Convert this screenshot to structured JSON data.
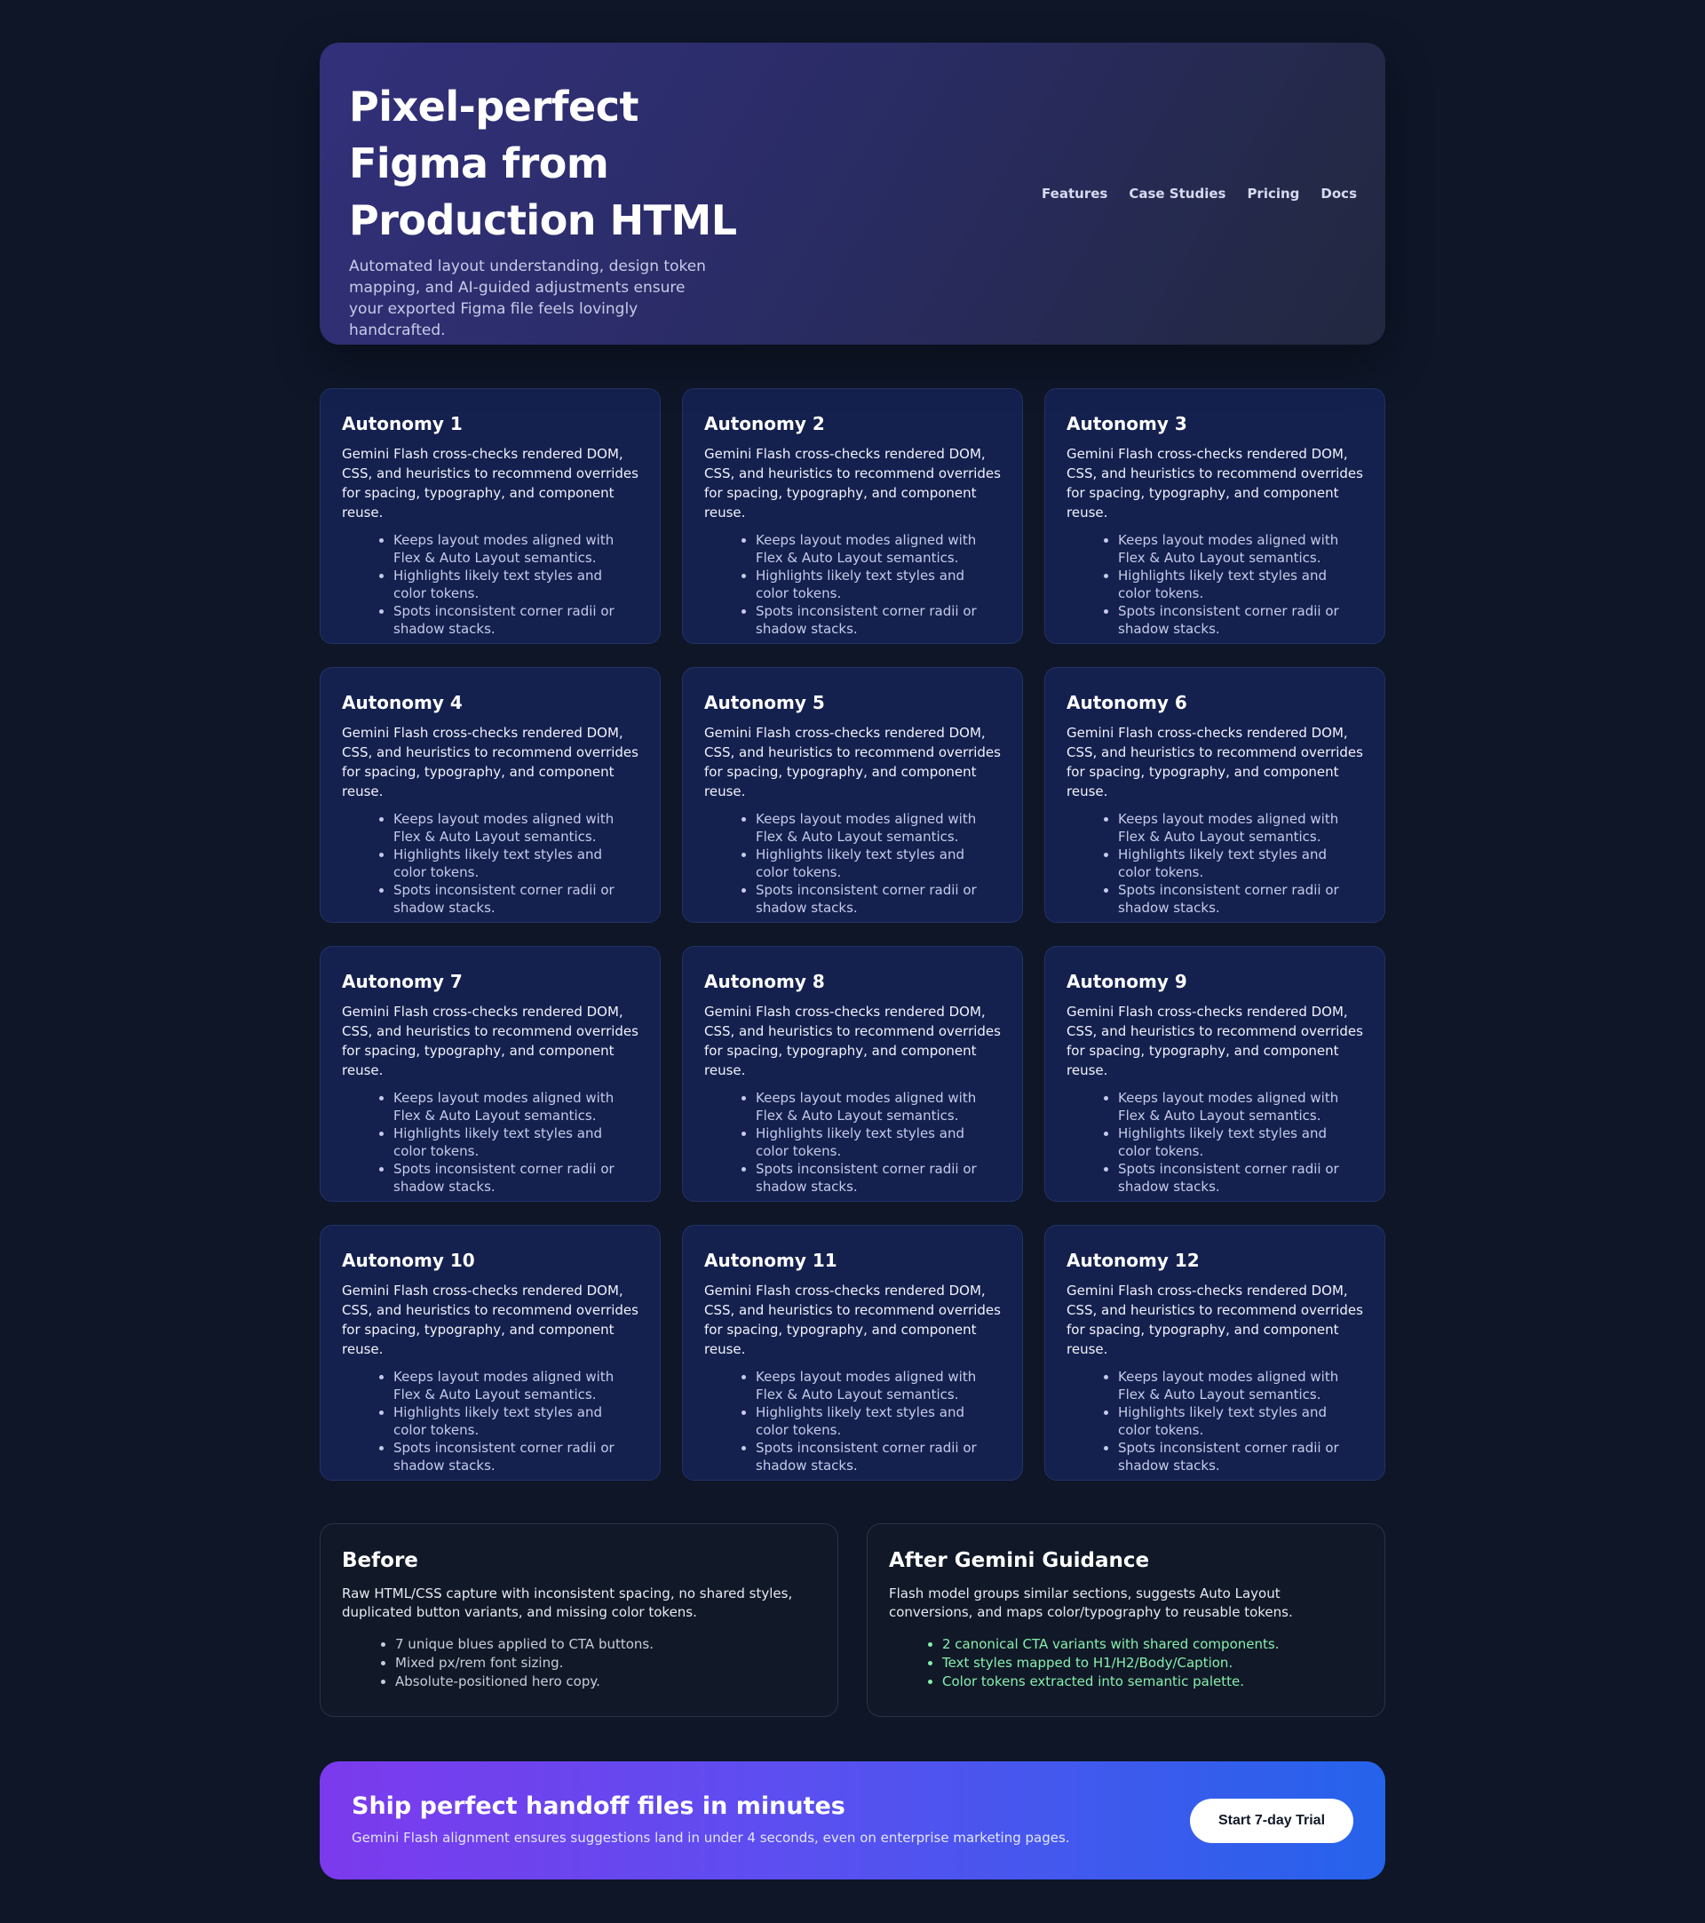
{
  "hero": {
    "title": "Pixel-perfect Figma from Production HTML",
    "subtitle": "Automated layout understanding, design token mapping, and AI-guided adjustments ensure your exported Figma file feels lovingly handcrafted.",
    "nav": [
      "Features",
      "Case Studies",
      "Pricing",
      "Docs"
    ]
  },
  "cards": [
    {
      "title": "Autonomy 1",
      "body": "Gemini Flash cross-checks rendered DOM, CSS, and heuristics to recommend overrides for spacing, typography, and component reuse.",
      "bullets": [
        "Keeps layout modes aligned with Flex & Auto Layout semantics.",
        "Highlights likely text styles and color tokens.",
        "Spots inconsistent corner radii or shadow stacks."
      ]
    },
    {
      "title": "Autonomy 2",
      "body": "Gemini Flash cross-checks rendered DOM, CSS, and heuristics to recommend overrides for spacing, typography, and component reuse.",
      "bullets": [
        "Keeps layout modes aligned with Flex & Auto Layout semantics.",
        "Highlights likely text styles and color tokens.",
        "Spots inconsistent corner radii or shadow stacks."
      ]
    },
    {
      "title": "Autonomy 3",
      "body": "Gemini Flash cross-checks rendered DOM, CSS, and heuristics to recommend overrides for spacing, typography, and component reuse.",
      "bullets": [
        "Keeps layout modes aligned with Flex & Auto Layout semantics.",
        "Highlights likely text styles and color tokens.",
        "Spots inconsistent corner radii or shadow stacks."
      ]
    },
    {
      "title": "Autonomy 4",
      "body": "Gemini Flash cross-checks rendered DOM, CSS, and heuristics to recommend overrides for spacing, typography, and component reuse.",
      "bullets": [
        "Keeps layout modes aligned with Flex & Auto Layout semantics.",
        "Highlights likely text styles and color tokens.",
        "Spots inconsistent corner radii or shadow stacks."
      ]
    },
    {
      "title": "Autonomy 5",
      "body": "Gemini Flash cross-checks rendered DOM, CSS, and heuristics to recommend overrides for spacing, typography, and component reuse.",
      "bullets": [
        "Keeps layout modes aligned with Flex & Auto Layout semantics.",
        "Highlights likely text styles and color tokens.",
        "Spots inconsistent corner radii or shadow stacks."
      ]
    },
    {
      "title": "Autonomy 6",
      "body": "Gemini Flash cross-checks rendered DOM, CSS, and heuristics to recommend overrides for spacing, typography, and component reuse.",
      "bullets": [
        "Keeps layout modes aligned with Flex & Auto Layout semantics.",
        "Highlights likely text styles and color tokens.",
        "Spots inconsistent corner radii or shadow stacks."
      ]
    },
    {
      "title": "Autonomy 7",
      "body": "Gemini Flash cross-checks rendered DOM, CSS, and heuristics to recommend overrides for spacing, typography, and component reuse.",
      "bullets": [
        "Keeps layout modes aligned with Flex & Auto Layout semantics.",
        "Highlights likely text styles and color tokens.",
        "Spots inconsistent corner radii or shadow stacks."
      ]
    },
    {
      "title": "Autonomy 8",
      "body": "Gemini Flash cross-checks rendered DOM, CSS, and heuristics to recommend overrides for spacing, typography, and component reuse.",
      "bullets": [
        "Keeps layout modes aligned with Flex & Auto Layout semantics.",
        "Highlights likely text styles and color tokens.",
        "Spots inconsistent corner radii or shadow stacks."
      ]
    },
    {
      "title": "Autonomy 9",
      "body": "Gemini Flash cross-checks rendered DOM, CSS, and heuristics to recommend overrides for spacing, typography, and component reuse.",
      "bullets": [
        "Keeps layout modes aligned with Flex & Auto Layout semantics.",
        "Highlights likely text styles and color tokens.",
        "Spots inconsistent corner radii or shadow stacks."
      ]
    },
    {
      "title": "Autonomy 10",
      "body": "Gemini Flash cross-checks rendered DOM, CSS, and heuristics to recommend overrides for spacing, typography, and component reuse.",
      "bullets": [
        "Keeps layout modes aligned with Flex & Auto Layout semantics.",
        "Highlights likely text styles and color tokens.",
        "Spots inconsistent corner radii or shadow stacks."
      ]
    },
    {
      "title": "Autonomy 11",
      "body": "Gemini Flash cross-checks rendered DOM, CSS, and heuristics to recommend overrides for spacing, typography, and component reuse.",
      "bullets": [
        "Keeps layout modes aligned with Flex & Auto Layout semantics.",
        "Highlights likely text styles and color tokens.",
        "Spots inconsistent corner radii or shadow stacks."
      ]
    },
    {
      "title": "Autonomy 12",
      "body": "Gemini Flash cross-checks rendered DOM, CSS, and heuristics to recommend overrides for spacing, typography, and component reuse.",
      "bullets": [
        "Keeps layout modes aligned with Flex & Auto Layout semantics.",
        "Highlights likely text styles and color tokens.",
        "Spots inconsistent corner radii or shadow stacks."
      ]
    }
  ],
  "compare": {
    "before": {
      "title": "Before",
      "body": "Raw HTML/CSS capture with inconsistent spacing, no shared styles, duplicated button variants, and missing color tokens.",
      "bullets": [
        "7 unique blues applied to CTA buttons.",
        "Mixed px/rem font sizing.",
        "Absolute-positioned hero copy."
      ]
    },
    "after": {
      "title": "After Gemini Guidance",
      "body": "Flash model groups similar sections, suggests Auto Layout conversions, and maps color/typography to reusable tokens.",
      "bullets": [
        "2 canonical CTA variants with shared components.",
        "Text styles mapped to H1/H2/Body/Caption.",
        "Color tokens extracted into semantic palette."
      ]
    }
  },
  "cta": {
    "title": "Ship perfect handoff files in minutes",
    "subtitle": "Gemini Flash alignment ensures suggestions land in under 4 seconds, even on enterprise marketing pages.",
    "button_label": "Start 7-day Trial"
  },
  "colors": {
    "background": "#0e1628",
    "card": "#14204e",
    "after_bullets": "#86efac",
    "cta_gradient_start": "#7c3aed",
    "cta_gradient_end": "#2563eb"
  }
}
